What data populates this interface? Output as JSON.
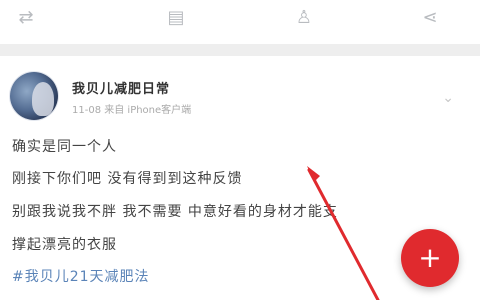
{
  "toolbar": {
    "icons": [
      {
        "name": "repost-icon",
        "glyph": "⇄"
      },
      {
        "name": "comment-icon",
        "glyph": "▤"
      },
      {
        "name": "like-icon",
        "glyph": "♙"
      },
      {
        "name": "share-icon",
        "glyph": "⋖"
      }
    ]
  },
  "post": {
    "author": "我贝儿减肥日常",
    "meta": "11-08  来自 iPhone客户端",
    "chevron": "⌄",
    "lines": [
      "确实是同一个人",
      "刚接下你们吧 没有得到到这种反馈",
      "别跟我说我不胖 我不需要 中意好看的身材才能支",
      "撑起漂亮的衣服"
    ],
    "hashtag": "#我贝儿21天减肥法"
  },
  "fab": {
    "label": "+"
  },
  "colors": {
    "fab": "#e02a2e",
    "annotation_arrow": "#e02a2e",
    "hashtag": "#5b84b8"
  }
}
